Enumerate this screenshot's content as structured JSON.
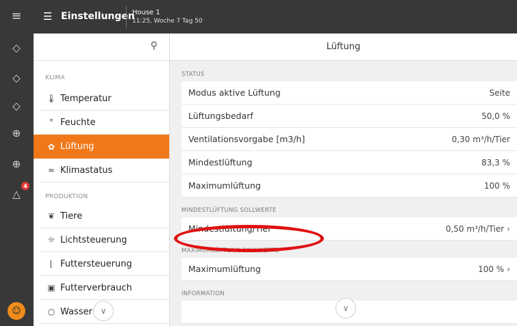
{
  "rail": {
    "menu_icon": "hamburger-icon",
    "badge_count": "4"
  },
  "topbar": {
    "title": "Einstellungen",
    "house_name": "House 1",
    "house_time": "11:25, Woche 7 Tag 50"
  },
  "sidebar": {
    "sections": [
      {
        "label": "KLIMA",
        "items": [
          {
            "label": "Temperatur",
            "icon": "thermometer-icon"
          },
          {
            "label": "Feuchte",
            "icon": "humidity-icon"
          },
          {
            "label": "Lüftung",
            "icon": "fan-icon",
            "active": true
          },
          {
            "label": "Klimastatus",
            "icon": "climate-status-icon"
          }
        ]
      },
      {
        "label": "PRODUKTION",
        "items": [
          {
            "label": "Tiere",
            "icon": "animals-icon"
          },
          {
            "label": "Lichtsteuerung",
            "icon": "light-icon"
          },
          {
            "label": "Futtersteuerung",
            "icon": "feed-control-icon"
          },
          {
            "label": "Futterverbrauch",
            "icon": "feed-consumption-icon"
          },
          {
            "label": "Wasser",
            "icon": "water-icon"
          }
        ]
      }
    ]
  },
  "main": {
    "title": "Lüftung",
    "status_label": "STATUS",
    "status_rows": [
      {
        "label": "Modus aktive Lüftung",
        "value": "Seite"
      },
      {
        "label": "Lüftungsbedarf",
        "value": "50,0 %"
      },
      {
        "label": "Ventilationsvorgabe [m3/h]",
        "value": "0,30 m³/h/Tier"
      },
      {
        "label": "Mindestlüftung",
        "value": "83,3 %"
      },
      {
        "label": "Maximumlüftung",
        "value": "100 %"
      }
    ],
    "min_section_label": "MINDESTLÜFTUNG SOLLWERTE",
    "min_row": {
      "label": "Mindestlüftung/Tier",
      "value": "0,50 m³/h/Tier"
    },
    "max_section_label": "MAXIMUMLÜFTUNG SOLLWERTE",
    "max_row": {
      "label": "Maximumlüftung",
      "value": "100 %"
    },
    "info_label": "INFORMATION"
  },
  "colors": {
    "accent": "#f07818",
    "dark": "#383838",
    "highlight": "#e01010"
  }
}
